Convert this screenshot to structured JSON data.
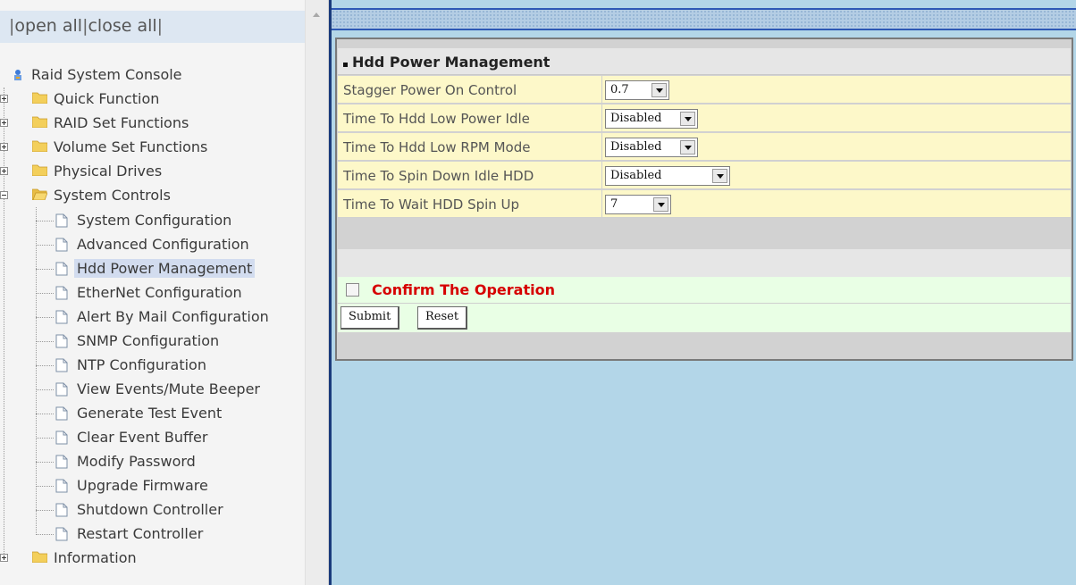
{
  "tree_header": {
    "open_all": "open all",
    "close_all": "close all",
    "separator": "|"
  },
  "tree": {
    "root": "Raid System Console",
    "folders": [
      {
        "label": "Quick Function",
        "expanded": false
      },
      {
        "label": "RAID Set Functions",
        "expanded": false
      },
      {
        "label": "Volume Set Functions",
        "expanded": false
      },
      {
        "label": "Physical Drives",
        "expanded": false
      },
      {
        "label": "System Controls",
        "expanded": true
      },
      {
        "label": "Information",
        "expanded": false
      }
    ],
    "system_controls_items": [
      "System Configuration",
      "Advanced Configuration",
      "Hdd Power Management",
      "EtherNet Configuration",
      "Alert By Mail Configuration",
      "SNMP Configuration",
      "NTP Configuration",
      "View Events/Mute Beeper",
      "Generate Test Event",
      "Clear Event Buffer",
      "Modify Password",
      "Upgrade Firmware",
      "Shutdown Controller",
      "Restart Controller"
    ],
    "selected_item": "Hdd Power Management"
  },
  "panel": {
    "title": "Hdd Power Management",
    "rows": [
      {
        "label": "Stagger Power On Control",
        "value": "0.7"
      },
      {
        "label": "Time To Hdd Low Power Idle",
        "value": "Disabled"
      },
      {
        "label": "Time To Hdd Low RPM Mode",
        "value": "Disabled"
      },
      {
        "label": "Time To Spin Down Idle HDD",
        "value": "Disabled"
      },
      {
        "label": "Time To Wait HDD Spin Up",
        "value": "7"
      }
    ],
    "confirm_label": "Confirm The Operation",
    "submit_label": "Submit",
    "reset_label": "Reset"
  },
  "colors": {
    "frame_background": "#b3d6e8",
    "row_background": "#fdf8c9",
    "confirm_background": "#e9ffe5",
    "confirm_text": "#d60000",
    "selected_highlight": "#d2dcef"
  }
}
